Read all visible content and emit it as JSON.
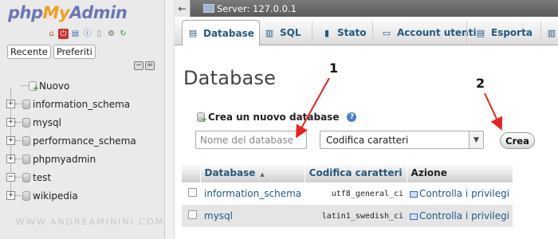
{
  "nav": {
    "logo": {
      "php": "php",
      "my": "My",
      "admin": "Admin"
    },
    "toolbar_icons": [
      "home-icon",
      "exit-icon",
      "database-icon",
      "docs-icon",
      "sql-docs-icon",
      "settings-icon",
      "reload-icon"
    ],
    "tabs": {
      "recent": "Recente",
      "favorites": "Preferiti"
    },
    "tree": [
      {
        "label": "Nuovo",
        "type": "new"
      },
      {
        "label": "information_schema",
        "type": "db"
      },
      {
        "label": "mysql",
        "type": "db"
      },
      {
        "label": "performance_schema",
        "type": "db"
      },
      {
        "label": "phpmyadmin",
        "type": "db"
      },
      {
        "label": "test",
        "type": "db",
        "expanded": true
      },
      {
        "label": "wikipedia",
        "type": "db"
      }
    ]
  },
  "serverbar": {
    "label": "Server: 127.0.0.1"
  },
  "topnav": {
    "tabs": [
      {
        "label": "Database",
        "active": true
      },
      {
        "label": "SQL"
      },
      {
        "label": "Stato"
      },
      {
        "label": "Account utenti"
      },
      {
        "label": "Esporta"
      }
    ]
  },
  "main": {
    "title": "Database",
    "create": {
      "heading": "Crea un nuovo database",
      "name_placeholder": "Nome del database",
      "charset_value": "Codifica caratteri",
      "create_button": "Crea"
    },
    "table": {
      "headers": [
        "Database",
        "Codifica caratteri",
        "Azione"
      ],
      "rows": [
        {
          "name": "information_schema",
          "collation": "utf8_general_ci",
          "action": "Controlla i privilegi"
        },
        {
          "name": "mysql",
          "collation": "latin1_swedish_ci",
          "action": "Controlla i privilegi"
        }
      ]
    }
  },
  "annotations": {
    "one": "1",
    "two": "2",
    "arrow_color": "#e8231d"
  },
  "watermark": "WWW.ANDREAMININI.COM",
  "colors": {
    "link": "#235a81",
    "nav_bg": "#eaeaea",
    "serverbar": "#6a6a6a"
  }
}
